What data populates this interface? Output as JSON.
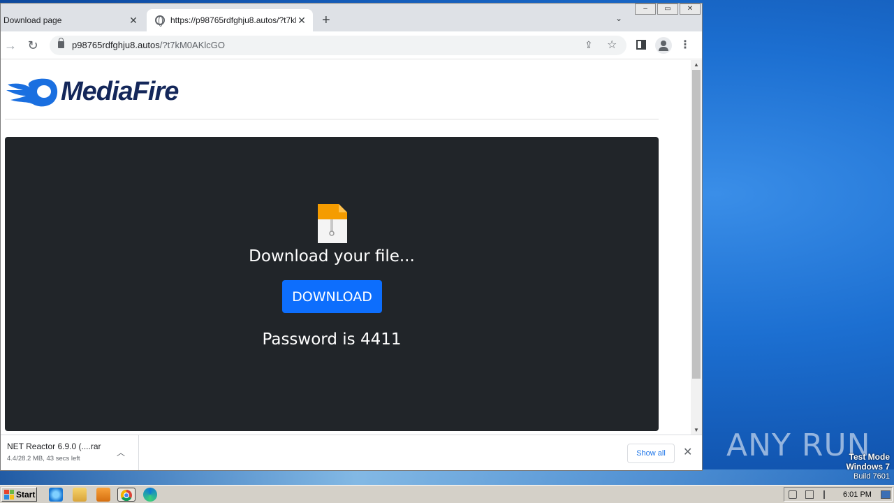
{
  "browser": {
    "tabs": [
      {
        "title": "Download page",
        "active": false
      },
      {
        "title": "https://p98765rdfghju8.autos/?t7kM",
        "active": true
      }
    ],
    "window_controls": [
      "–",
      "▭",
      "✕"
    ],
    "address": {
      "host": "p98765rdfghju8.autos",
      "path": "/?t7kM0AKlcGO"
    },
    "new_tab_glyph": "+",
    "tab_search_glyph": "⌄"
  },
  "page": {
    "logo_text": "MediaFire",
    "heading": "Download your file...",
    "download_button": "DOWNLOAD",
    "password_text": "Password is 4411",
    "colors": {
      "panel": "#212529",
      "button": "#0d6efd",
      "logo": "#14275a",
      "flame": "#1a6fe0"
    }
  },
  "download_shelf": {
    "item_name": "NET Reactor 6.9.0 (....rar",
    "item_status": "4.4/28.2 MB, 43 secs left",
    "show_all": "Show all"
  },
  "desktop": {
    "watermark": "ANY RUN",
    "test_mode": [
      "Test Mode",
      "Windows 7",
      "Build 7601"
    ]
  },
  "taskbar": {
    "start_label": "Start",
    "pinned": [
      "ie-icon",
      "explorer-icon",
      "media-player-icon",
      "chrome-icon",
      "edge-icon"
    ],
    "clock": "6:01 PM"
  }
}
